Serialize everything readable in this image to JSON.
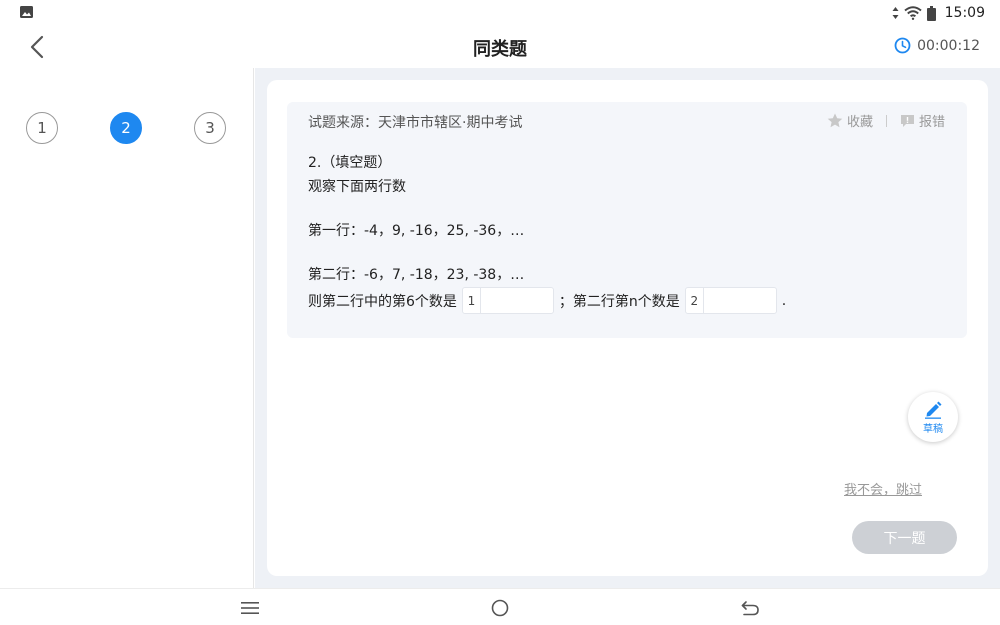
{
  "status_bar": {
    "time": "15:09"
  },
  "header": {
    "title": "同类题",
    "timer": "00:00:12"
  },
  "question_numbers": [
    {
      "label": "1",
      "active": false
    },
    {
      "label": "2",
      "active": true
    },
    {
      "label": "3",
      "active": false
    }
  ],
  "question": {
    "source": "试题来源：天津市市辖区·期中考试",
    "favorite_label": "收藏",
    "report_label": "报错",
    "type_line": "2.（填空题）",
    "stem": "观察下面两行数",
    "row1": "第一行：-4，9, -16，25, -36，…",
    "row2": "第二行：-6，7, -18，23, -38，…",
    "fill_prefix": "则第二行中的第6个数是",
    "blank1": "1",
    "fill_middle": "；第二行第n个数是",
    "blank2": "2",
    "fill_suffix": "."
  },
  "draft_label": "草稿",
  "skip_label": "我不会，跳过",
  "next_label": "下一题",
  "colors": {
    "accent": "#1e88f0",
    "next_disabled": "#cdd0d5",
    "main_bg": "#eef1f6",
    "question_bg": "#f4f6fa"
  },
  "icons": [
    "photo-icon",
    "wifi-icon",
    "data-arrows-icon",
    "battery-icon",
    "back-arrow-icon",
    "clock-icon",
    "star-icon",
    "report-icon",
    "pencil-icon",
    "menu-icon",
    "home-circle-icon",
    "return-icon"
  ]
}
